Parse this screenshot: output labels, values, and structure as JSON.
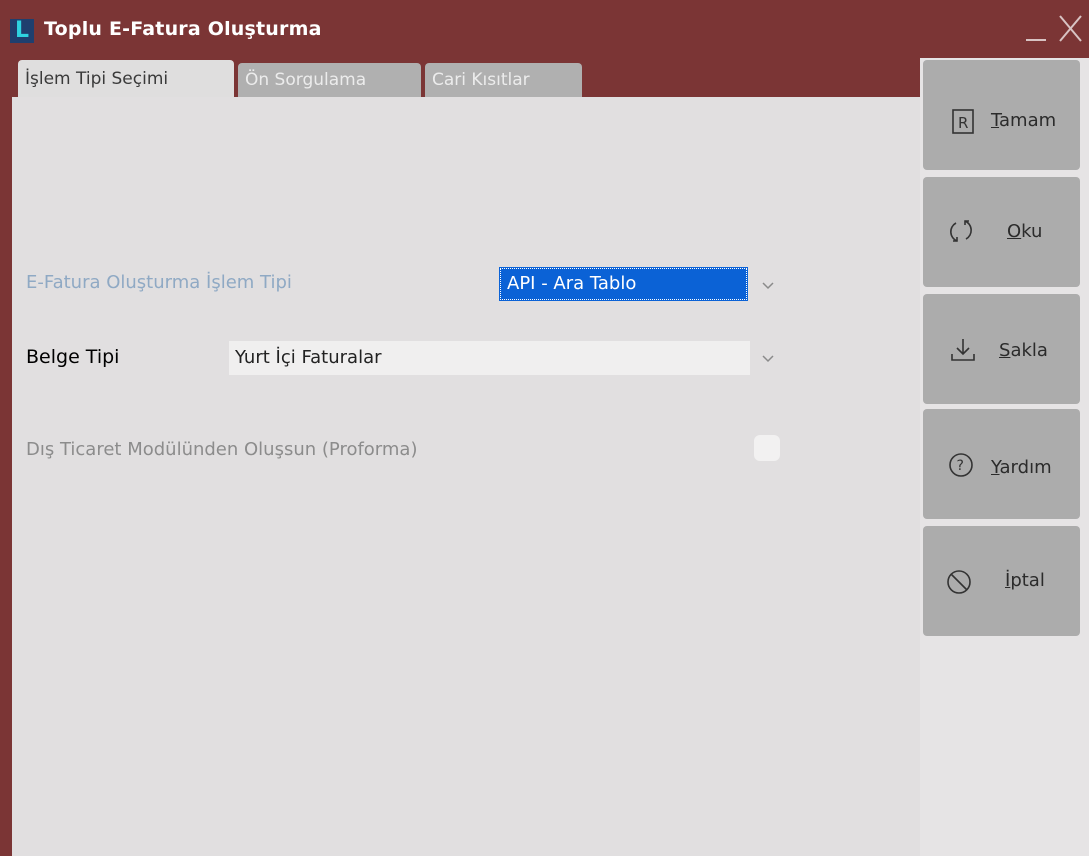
{
  "window": {
    "title": "Toplu E-Fatura Oluşturma",
    "logo_letter": "L"
  },
  "tabs": [
    {
      "label": "İşlem Tipi Seçimi",
      "active": true
    },
    {
      "label": "Ön Sorgulama",
      "active": false
    },
    {
      "label": "Cari Kısıtlar",
      "active": false
    }
  ],
  "form": {
    "islem_tipi": {
      "label": "E-Fatura Oluşturma İşlem Tipi",
      "value": "API - Ara Tablo"
    },
    "belge_tipi": {
      "label": "Belge Tipi",
      "value": "Yurt İçi Faturalar"
    },
    "dis_ticaret": {
      "label": "Dış Ticaret Modülünden Oluşsun (Proforma)",
      "checked": false
    }
  },
  "sidebar": {
    "buttons": [
      {
        "label": "Tamam",
        "icon": "r-box-icon"
      },
      {
        "label": "Oku",
        "icon": "refresh-icon"
      },
      {
        "label": "Sakla",
        "icon": "download-icon"
      },
      {
        "label": "Yardım",
        "icon": "help-icon"
      },
      {
        "label": "İptal",
        "icon": "cancel-icon"
      }
    ]
  },
  "colors": {
    "titlebar": "#7b3535",
    "selection": "#0b62d6",
    "side_button": "#acacac"
  }
}
